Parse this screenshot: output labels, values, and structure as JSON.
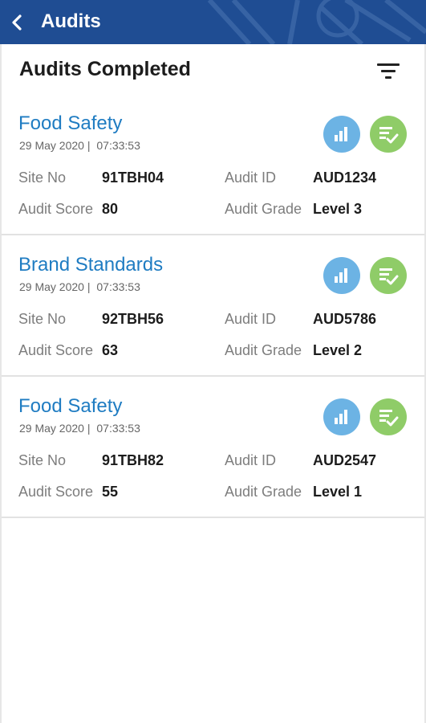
{
  "appbar": {
    "title": "Audits"
  },
  "page": {
    "subtitle": "Audits Completed"
  },
  "labels": {
    "site_no": "Site No",
    "audit_id": "Audit ID",
    "audit_score": "Audit Score",
    "audit_grade": "Audit Grade"
  },
  "icons": {
    "back": "chevron-left-icon",
    "filter": "filter-icon",
    "stats": "bar-chart-icon",
    "checklist": "checklist-icon"
  },
  "colors": {
    "appbar": "#1f4d93",
    "title_blue": "#1f7cc2",
    "stats_circle": "#6cb3e4",
    "check_circle": "#8fcc68"
  },
  "audits": [
    {
      "name": "Food Safety",
      "date": "29 May 2020 |",
      "time": "07:33:53",
      "site_no": "91TBH04",
      "audit_id": "AUD1234",
      "score": "80",
      "grade": "Level 3"
    },
    {
      "name": "Brand Standards",
      "date": "29 May 2020 |",
      "time": "07:33:53",
      "site_no": "92TBH56",
      "audit_id": "AUD5786",
      "score": "63",
      "grade": "Level 2"
    },
    {
      "name": "Food Safety",
      "date": "29 May 2020 |",
      "time": "07:33:53",
      "site_no": "91TBH82",
      "audit_id": "AUD2547",
      "score": "55",
      "grade": "Level 1"
    }
  ]
}
